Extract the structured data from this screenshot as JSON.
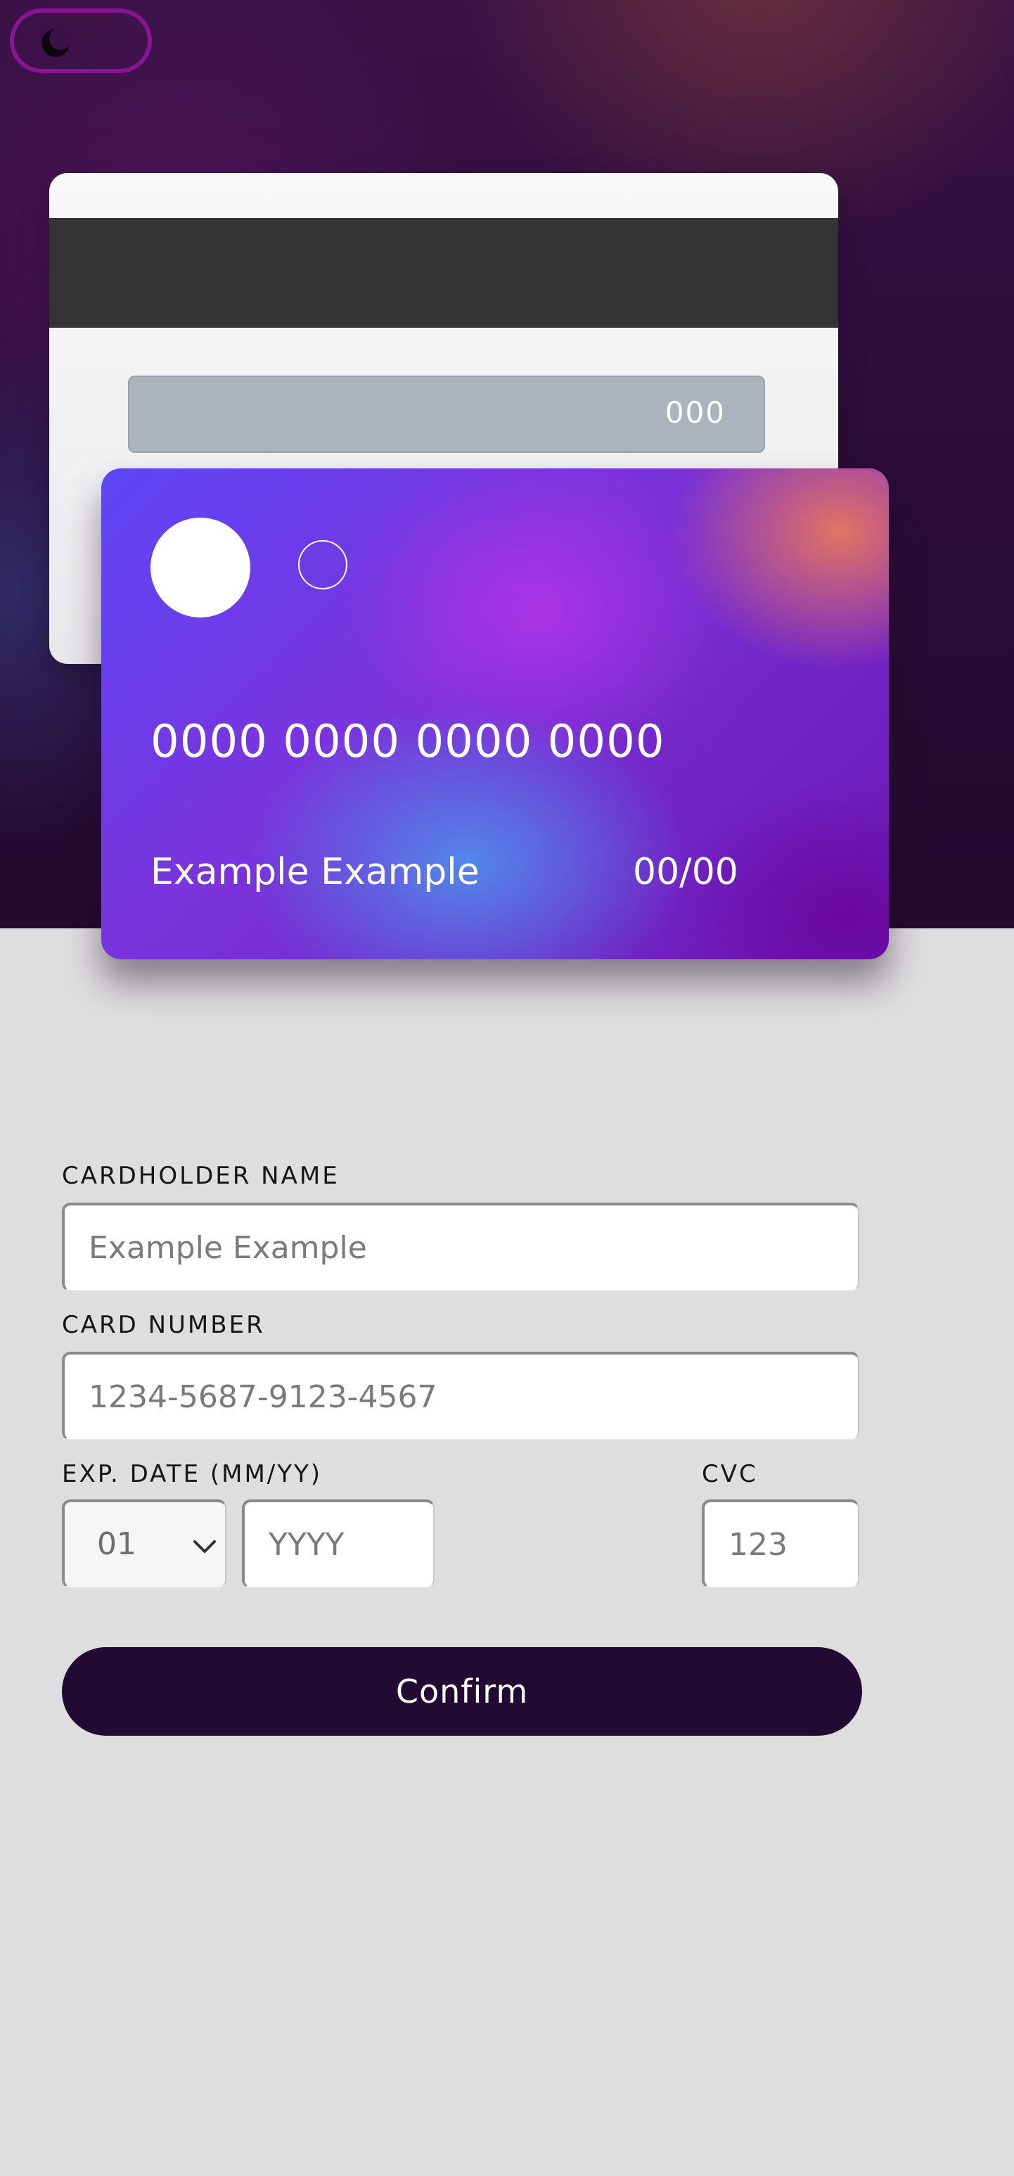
{
  "card_back": {
    "cvc": "000"
  },
  "card_front": {
    "number": "0000 0000 0000 0000",
    "name": "Example Example",
    "expiry": "00/00"
  },
  "form": {
    "cardholder_name": {
      "label": "CARDHOLDER NAME",
      "placeholder": "Example Example"
    },
    "card_number": {
      "label": "CARD NUMBER",
      "placeholder": "1234-5687-9123-4567"
    },
    "exp_date": {
      "label": "EXP. DATE (MM/YY)",
      "month_selected": "01",
      "year_placeholder": "YYYY"
    },
    "cvc": {
      "label": "CVC",
      "placeholder": "123"
    },
    "confirm_label": "Confirm"
  },
  "icons": {
    "theme_toggle": "moon-icon",
    "month_dropdown": "chevron-down-icon"
  },
  "colors": {
    "toggle_border": "#8a1496",
    "button_bg": "#230a33",
    "page_bg": "#dedede",
    "hero_bg": "#2a0c36"
  }
}
